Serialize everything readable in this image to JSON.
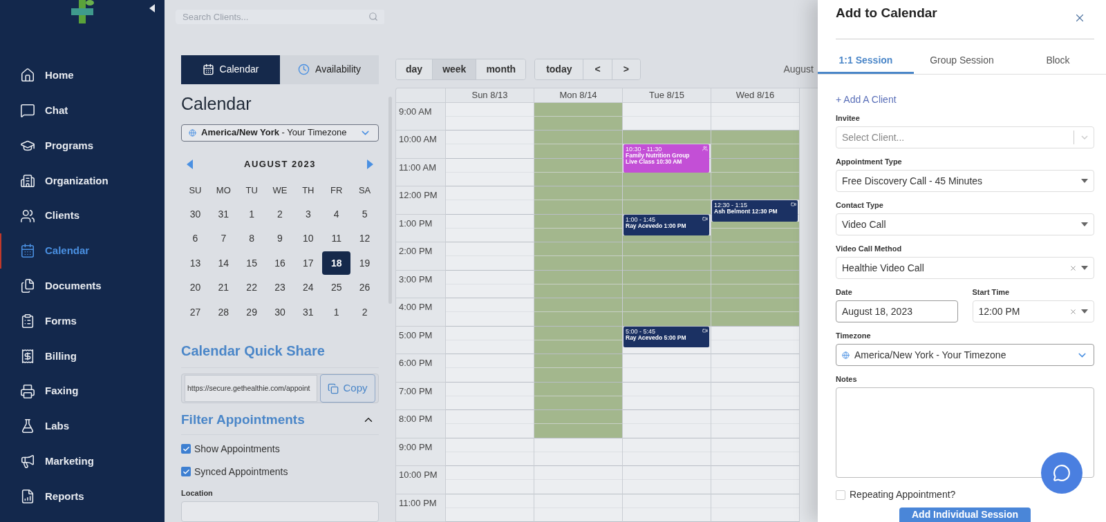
{
  "sidebar": {
    "items": [
      {
        "label": "Home",
        "selected": false
      },
      {
        "label": "Chat",
        "selected": false
      },
      {
        "label": "Programs",
        "selected": false
      },
      {
        "label": "Organization",
        "selected": false
      },
      {
        "label": "Clients",
        "selected": false
      },
      {
        "label": "Calendar",
        "selected": true
      },
      {
        "label": "Documents",
        "selected": false
      },
      {
        "label": "Forms",
        "selected": false
      },
      {
        "label": "Billing",
        "selected": false
      },
      {
        "label": "Faxing",
        "selected": false
      },
      {
        "label": "Labs",
        "selected": false
      },
      {
        "label": "Marketing",
        "selected": false
      },
      {
        "label": "Reports",
        "selected": false
      }
    ]
  },
  "search": {
    "placeholder": "Search Clients..."
  },
  "view_toggle": [
    {
      "label": "Calendar",
      "selected": true
    },
    {
      "label": "Availability",
      "selected": false
    }
  ],
  "calendar_title": "Calendar",
  "timezone": "**America/New York** - Your Timezone",
  "mini_calendar": {
    "month": "AUGUST 2023",
    "weekdays": [
      "SU",
      "MO",
      "TU",
      "WE",
      "TH",
      "FR",
      "SA"
    ],
    "weeks": [
      [
        {
          "day": "30",
          "selected": false
        },
        {
          "day": "31",
          "selected": false
        },
        {
          "day": "1",
          "selected": false
        },
        {
          "day": "2",
          "selected": false
        },
        {
          "day": "3",
          "selected": false
        },
        {
          "day": "4",
          "selected": false
        },
        {
          "day": "5",
          "selected": false
        }
      ],
      [
        {
          "day": "6",
          "selected": false
        },
        {
          "day": "7",
          "selected": false
        },
        {
          "day": "8",
          "selected": false
        },
        {
          "day": "9",
          "selected": false
        },
        {
          "day": "10",
          "selected": false
        },
        {
          "day": "11",
          "selected": false
        },
        {
          "day": "12",
          "selected": false
        }
      ],
      [
        {
          "day": "13",
          "selected": false
        },
        {
          "day": "14",
          "selected": false
        },
        {
          "day": "15",
          "selected": false
        },
        {
          "day": "16",
          "selected": false
        },
        {
          "day": "17",
          "selected": false
        },
        {
          "day": "18",
          "selected": true
        },
        {
          "day": "19",
          "selected": false
        }
      ],
      [
        {
          "day": "20",
          "selected": false
        },
        {
          "day": "21",
          "selected": false
        },
        {
          "day": "22",
          "selected": false
        },
        {
          "day": "23",
          "selected": false
        },
        {
          "day": "24",
          "selected": false
        },
        {
          "day": "25",
          "selected": false
        },
        {
          "day": "26",
          "selected": false
        }
      ],
      [
        {
          "day": "27",
          "selected": false
        },
        {
          "day": "28",
          "selected": false
        },
        {
          "day": "29",
          "selected": false
        },
        {
          "day": "30",
          "selected": false
        },
        {
          "day": "31",
          "selected": false
        },
        {
          "day": "1",
          "selected": false
        },
        {
          "day": "2",
          "selected": false
        }
      ]
    ]
  },
  "quick_share": {
    "title": "Calendar Quick Share",
    "url": "https://secure.gethealthie.com/appoint",
    "button": "Copy"
  },
  "filter": {
    "title": "Filter Appointments",
    "expanded": true,
    "options": [
      {
        "label": "Show Appointments",
        "checked": true
      },
      {
        "label": "Synced Appointments",
        "checked": true
      }
    ],
    "location_label": "Location"
  },
  "week_view": {
    "views": [
      {
        "label": "day",
        "selected": false
      },
      {
        "label": "week",
        "selected": true
      },
      {
        "label": "month",
        "selected": false
      }
    ],
    "nav": [
      "today",
      "<",
      ">"
    ],
    "range_label": "August",
    "hours": [
      "9:00 AM",
      "10:00 AM",
      "11:00 AM",
      "12:00 PM",
      "1:00 PM",
      "2:00 PM",
      "3:00 PM",
      "4:00 PM",
      "5:00 PM",
      "6:00 PM",
      "7:00 PM",
      "8:00 PM",
      "9:00 PM",
      "10:00 PM",
      "11:00 PM"
    ],
    "days": [
      {
        "label": "Sun 8/13",
        "slots": [
          {
            "available": false
          },
          {
            "available": false
          },
          {
            "available": false
          },
          {
            "available": false
          },
          {
            "available": false
          },
          {
            "available": false
          },
          {
            "available": false
          },
          {
            "available": false
          },
          {
            "available": false
          },
          {
            "available": false
          },
          {
            "available": false
          },
          {
            "available": false
          },
          {
            "available": false
          },
          {
            "available": false
          },
          {
            "available": false
          }
        ]
      },
      {
        "label": "Mon 8/14",
        "slots": [
          {
            "available": true
          },
          {
            "available": true
          },
          {
            "available": true
          },
          {
            "available": true
          },
          {
            "available": true
          },
          {
            "available": true
          },
          {
            "available": true
          },
          {
            "available": true
          },
          {
            "available": true
          },
          {
            "available": true
          },
          {
            "available": true
          },
          {
            "available": true
          },
          {
            "available": false
          },
          {
            "available": false
          },
          {
            "available": false
          }
        ]
      },
      {
        "label": "Tue 8/15",
        "slots": [
          {
            "available": false
          },
          {
            "available": true
          },
          {
            "available": true
          },
          {
            "available": true
          },
          {
            "available": true
          },
          {
            "available": true
          },
          {
            "available": true
          },
          {
            "available": true
          },
          {
            "available": false
          },
          {
            "available": false
          },
          {
            "available": false
          },
          {
            "available": false
          },
          {
            "available": false
          },
          {
            "available": false
          },
          {
            "available": false
          }
        ],
        "events": [
          {
            "kind": "group",
            "time": "10:30 - 11:30",
            "title": "Family Nutrition Group Live Class 10:30 AM",
            "color": "#c34fd6"
          },
          {
            "kind": "video",
            "time": "1:00 - 1:45",
            "title": "Ray Acevedo 1:00 PM",
            "color": "#1b3163"
          },
          {
            "kind": "video",
            "time": "5:00 - 5:45",
            "title": "Ray Acevedo 5:00 PM",
            "color": "#1b3163"
          }
        ]
      },
      {
        "label": "Wed 8/16",
        "slots": [
          {
            "available": false
          },
          {
            "available": true
          },
          {
            "available": true
          },
          {
            "available": true
          },
          {
            "available": true
          },
          {
            "available": true
          },
          {
            "available": true
          },
          {
            "available": true
          },
          {
            "available": false
          },
          {
            "available": false
          },
          {
            "available": false
          },
          {
            "available": false
          },
          {
            "available": false
          },
          {
            "available": false
          },
          {
            "available": false
          }
        ],
        "events": [
          {
            "kind": "video",
            "time": "12:30 - 1:15",
            "title": "Ash Belmont 12:30 PM",
            "color": "#1b3163"
          }
        ]
      }
    ]
  },
  "panel": {
    "title": "Add to Calendar",
    "tabs": [
      {
        "label": "1:1 Session",
        "selected": true
      },
      {
        "label": "Group Session",
        "selected": false
      },
      {
        "label": "Block",
        "selected": false
      }
    ],
    "add_client": "+ Add A Client",
    "fields": [
      {
        "kind": "select",
        "label": "Invitee",
        "placeholder": "Select Client..."
      },
      {
        "kind": "select",
        "label": "Appointment Type",
        "value": "Free Discovery Call - 45 Minutes"
      },
      {
        "kind": "select",
        "label": "Contact Type",
        "value": "Video Call"
      },
      {
        "kind": "select",
        "label": "Video Call Method",
        "value": "Healthie Video Call",
        "clearable": true
      },
      {
        "kind": "pair",
        "fields": [
          {
            "kind": "text",
            "label": "Date",
            "value": "August 18, 2023"
          },
          {
            "kind": "select",
            "label": "Start Time",
            "value": "12:00 PM",
            "clearable": true
          }
        ]
      },
      {
        "kind": "timezone",
        "label": "Timezone",
        "value": "America/New York - Your Timezone"
      },
      {
        "kind": "textarea",
        "label": "Notes"
      }
    ],
    "repeating": {
      "label": "Repeating Appointment?",
      "checked": false
    },
    "submit": "Add Individual Session"
  }
}
